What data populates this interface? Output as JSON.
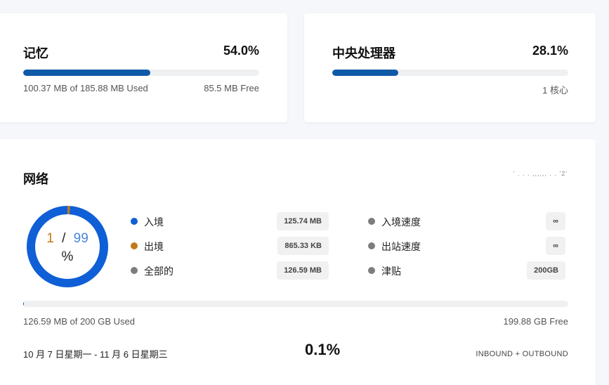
{
  "memory": {
    "title": "记忆",
    "percent": "54.0%",
    "fill_fraction": 0.54,
    "used_text": "100.37 MB of 185.88 MB Used",
    "free_text": "85.5 MB Free"
  },
  "cpu": {
    "title": "中央处理器",
    "percent": "28.1%",
    "fill_fraction": 0.281,
    "cores_text": "1 核心"
  },
  "network": {
    "title": "网络",
    "garbled_text": "' . . . ,,,,,, . . '2'",
    "donut": {
      "out_value": "1",
      "separator": "/",
      "in_value": "99",
      "unit": "%",
      "out_fraction": 0.01,
      "in_fraction": 0.99
    },
    "legend_left": [
      {
        "label": "入境",
        "value": "125.74 MB",
        "color": "#0f5fd6"
      },
      {
        "label": "出境",
        "value": "865.33 KB",
        "color": "#c07a18"
      },
      {
        "label": "全部的",
        "value": "126.59 MB",
        "color": "#7d7d7d"
      }
    ],
    "legend_right": [
      {
        "label": "入境速度",
        "value": "∞",
        "color": "#7d7d7d"
      },
      {
        "label": "出站速度",
        "value": "∞",
        "color": "#7d7d7d"
      },
      {
        "label": "津贴",
        "value": "200GB",
        "color": "#7d7d7d"
      }
    ],
    "usage_fraction": 0.001,
    "used_text": "126.59 MB of 200 GB Used",
    "free_text": "199.88 GB Free",
    "date_range": "10 月 7 日星期一 - 11 月 6 日星期三",
    "usage_percent": "0.1%",
    "direction_label": "INBOUND + OUTBOUND"
  },
  "colors": {
    "bar_fill": "#0f5aa8",
    "inbound": "#0f5fd6",
    "outbound": "#c07a18",
    "total": "#7d7d7d"
  }
}
